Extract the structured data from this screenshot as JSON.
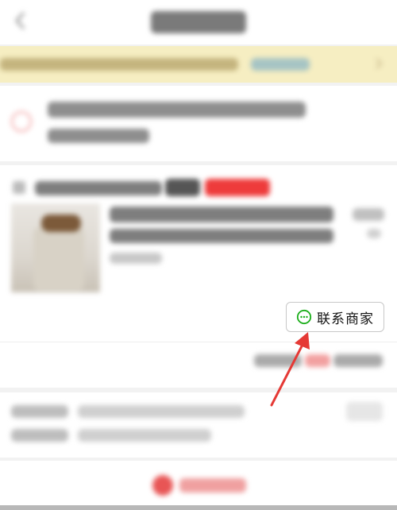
{
  "contact_button": {
    "label": "联系商家",
    "icon": "chat-bubble-icon",
    "icon_color": "#1aad19"
  },
  "annotation": {
    "arrow_color": "#e53935"
  },
  "colors": {
    "notice_background": "#f6eec2",
    "accent_red": "#ee3b3b"
  }
}
